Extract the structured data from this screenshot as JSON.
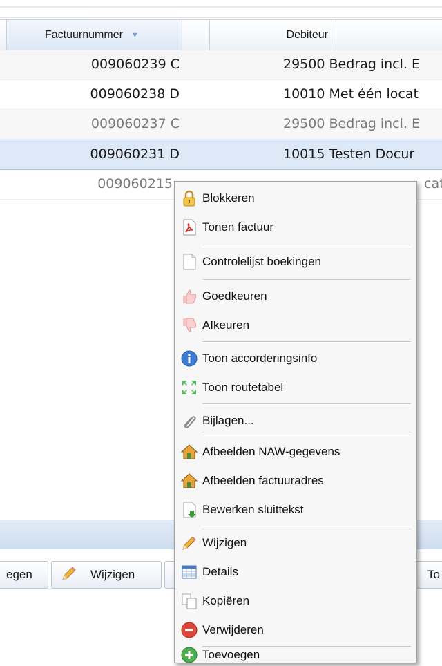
{
  "grid": {
    "columns": {
      "factuurnummer": "Factuurnummer",
      "debiteur": "Debiteur"
    },
    "rows": [
      {
        "factuurnummer": "009060239 C",
        "debiteur": "29500 Bedrag incl. E"
      },
      {
        "factuurnummer": "009060238 D",
        "debiteur": "10010 Met één locat"
      },
      {
        "factuurnummer": "009060237 C",
        "debiteur": "29500 Bedrag incl. E"
      },
      {
        "factuurnummer": "009060231 D",
        "debiteur": "10015 Testen Docur"
      },
      {
        "factuurnummer": "009060215",
        "debiteur": "cat"
      }
    ]
  },
  "toolbar": {
    "toevoegen_partial": "egen",
    "wijzigen": "Wijzigen",
    "toevoegen_right_partial": "To"
  },
  "context_menu": {
    "items": [
      {
        "label": "Blokkeren",
        "icon": "lock-icon"
      },
      {
        "label": "Tonen factuur",
        "icon": "pdf-icon"
      },
      {
        "label": "Controlelijst boekingen",
        "icon": "blank-document-icon"
      },
      {
        "label": "Goedkeuren",
        "icon": "thumbs-up-icon"
      },
      {
        "label": "Afkeuren",
        "icon": "thumbs-down-icon"
      },
      {
        "label": "Toon accorderingsinfo",
        "icon": "info-icon"
      },
      {
        "label": "Toon routetabel",
        "icon": "expand-arrows-icon"
      },
      {
        "label": "Bijlagen...",
        "icon": "paperclip-icon"
      },
      {
        "label": "Afbeelden NAW-gegevens",
        "icon": "house-icon"
      },
      {
        "label": "Afbeelden factuuradres",
        "icon": "house-icon"
      },
      {
        "label": "Bewerken sluittekst",
        "icon": "document-arrow-icon"
      },
      {
        "label": "Wijzigen",
        "icon": "pencil-icon"
      },
      {
        "label": "Details",
        "icon": "table-icon"
      },
      {
        "label": "Kopiëren",
        "icon": "copy-icon"
      },
      {
        "label": "Verwijderen",
        "icon": "minus-circle-icon"
      },
      {
        "label": "Toevoegen",
        "icon": "plus-circle-icon"
      }
    ]
  },
  "colors": {
    "selected_row": "#dde9f7",
    "header_gradient_end": "#dde8f6",
    "menu_background": "#f7f7f7",
    "delete_red": "#e0453a",
    "add_green": "#4caf50",
    "info_blue": "#3b7bd4"
  }
}
